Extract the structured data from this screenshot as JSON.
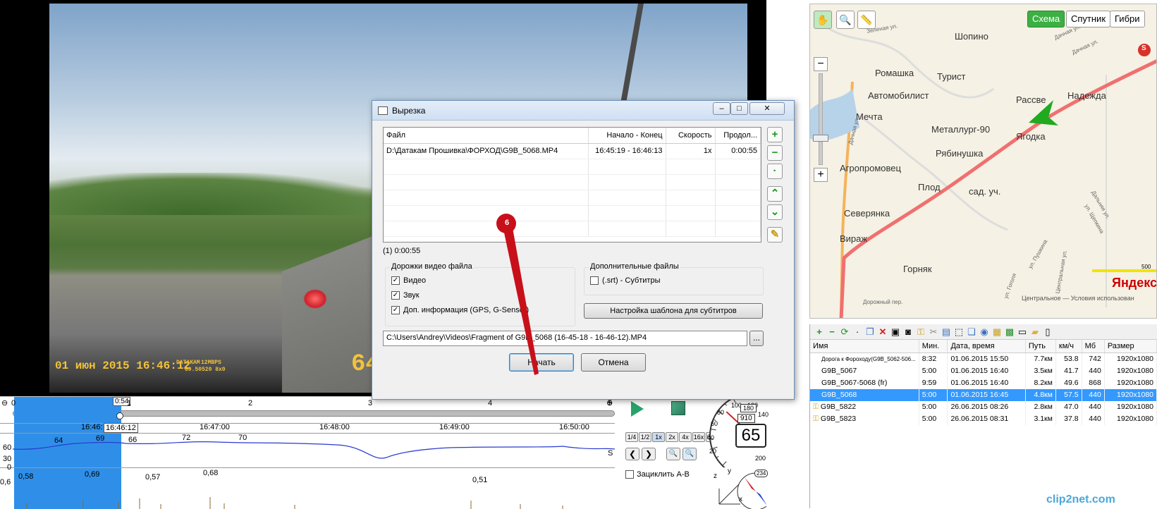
{
  "video": {
    "date_overlay": "01 июн 2015 16:46:12",
    "brand_overlay": "DATAKAM",
    "mbps_overlay": "12MBPS",
    "id_overlay": "G9.50520 8x0",
    "speed_overlay": "64"
  },
  "map": {
    "tools": {
      "hand": "hand-icon",
      "zoom": "zoom-box-icon",
      "ruler": "ruler-icon"
    },
    "buttons": {
      "scheme": "Схема",
      "satellite": "Спутник",
      "hybrid": "Гибри"
    },
    "zoom_minus": "−",
    "zoom_plus": "+",
    "towns": [
      "Шопино",
      "Ромашка",
      "Турист",
      "Автомобилист",
      "Рассве",
      "Надежда",
      "Мечта",
      "Металлург-90",
      "Ягодка",
      "Рябинушка",
      "Агропромовец",
      "Плод",
      "сад. уч.",
      "Северянка",
      "Вираж",
      "Горняк"
    ],
    "streets": [
      "Зеленая ул.",
      "Дачная ул.",
      "Дачная ул.",
      "Дачная ул.",
      "Дорожный пер.",
      "ул. Гоголя",
      "ул. Пушкина",
      "Центральная ул.",
      "Дальняя ул.",
      "ул. Щепкина"
    ],
    "marker_label": "S",
    "logo": "Яндекс",
    "scale": "500",
    "footer": "Центральное — Условия использован",
    "route_color": "#f07070",
    "button_active_color": "#3cb043"
  },
  "filepanel": {
    "toolbar_icons": [
      "plus-icon",
      "minus-icon",
      "refresh-icon",
      "dot-icon",
      "copy-icon",
      "delete-icon",
      "save-icon",
      "camera-icon",
      "key-icon",
      "scissors-icon",
      "add-icon",
      "crop-icon",
      "layers-icon",
      "globe-icon",
      "chart-icon",
      "picture-icon",
      "film-icon",
      "folder-icon",
      "doc-icon"
    ],
    "columns": [
      "Имя",
      "Мин.",
      "Дата, время",
      "Путь",
      "км/ч",
      "Мб",
      "Размер"
    ],
    "rows": [
      {
        "name": "Дорога к Фороходу(G9B_5062-506...",
        "min": "8:32",
        "date": "01.06.2015 15:50",
        "path": "7.7км",
        "speed": "53.8",
        "mb": "742",
        "size": "1920x1080",
        "selected": false,
        "key": false
      },
      {
        "name": "G9B_5067",
        "min": "5:00",
        "date": "01.06.2015 16:40",
        "path": "3.5км",
        "speed": "41.7",
        "mb": "440",
        "size": "1920x1080",
        "selected": false,
        "key": false
      },
      {
        "name": "G9B_5067-5068 (fr)",
        "min": "9:59",
        "date": "01.06.2015 16:40",
        "path": "8.2км",
        "speed": "49.6",
        "mb": "868",
        "size": "1920x1080",
        "selected": false,
        "key": false
      },
      {
        "name": "G9B_5068",
        "min": "5:00",
        "date": "01.06.2015 16:45",
        "path": "4.8км",
        "speed": "57.5",
        "mb": "440",
        "size": "1920x1080",
        "selected": true,
        "key": false
      },
      {
        "name": "G9B_5822",
        "min": "5:00",
        "date": "26.06.2015 08:26",
        "path": "2.8км",
        "speed": "47.0",
        "mb": "440",
        "size": "1920x1080",
        "selected": false,
        "key": true
      },
      {
        "name": "G9B_5823",
        "min": "5:00",
        "date": "26.06.2015 08:31",
        "path": "3.1км",
        "speed": "37.8",
        "mb": "440",
        "size": "1920x1080",
        "selected": false,
        "key": true
      }
    ],
    "watermark": "clip2net.com"
  },
  "timeline": {
    "minute_marks": [
      "1",
      "2",
      "3",
      "4",
      "5"
    ],
    "handle_label": "0:54",
    "zero": "0",
    "current_time": "16:46:12",
    "left_time": "16:46:",
    "times": [
      "16:47:00",
      "16:48:00",
      "16:49:00",
      "16:50:00"
    ],
    "speed_axis": [
      "60",
      "30",
      "0"
    ],
    "speed_labels": [
      "64",
      "69",
      "66",
      "72",
      "70"
    ],
    "speed_unit": "S",
    "g_axis": "0,6",
    "g_labels": [
      "0,58",
      "0,69",
      "0,57",
      "0,68",
      "0,51"
    ],
    "speed_buttons": [
      "1/4",
      "1/2",
      "1x",
      "2x",
      "4x",
      "16x",
      "64x"
    ],
    "loop_label": "Зациклить А-В",
    "speedometer": {
      "value": "65",
      "odometer": "910",
      "trip": "180",
      "ticks": [
        "20",
        "40",
        "60",
        "80",
        "100",
        "120",
        "140",
        "160",
        "180",
        "200"
      ],
      "speed_fraction": 0.325
    },
    "compass": {
      "heading": "234"
    },
    "axes": {
      "x": "x",
      "y": "y",
      "z": "z"
    }
  },
  "dialog": {
    "title": "Вырезка",
    "window_buttons": {
      "minimize": "–",
      "maximize": "□",
      "close": "✕"
    },
    "columns": [
      "Файл",
      "Начало - Конец",
      "Скорость",
      "Продол..."
    ],
    "rows": [
      {
        "file": "D:\\Датакам Прошивка\\ФОРХОД\\G9B_5068.MP4",
        "range": "16:45:19 - 16:46:13",
        "speed": "1x",
        "duration": "0:00:55"
      }
    ],
    "side_buttons": [
      "+",
      "−",
      "·",
      "⌃",
      "⌄",
      "✎"
    ],
    "summary": "(1) 0:00:55",
    "tracks_group": "Дорожки видео файла",
    "tracks": [
      {
        "label": "Видео",
        "checked": true
      },
      {
        "label": "Звук",
        "checked": true
      },
      {
        "label": "Доп. информация (GPS, G-Sensor)",
        "checked": true
      }
    ],
    "extra_group": "Дополнительные файлы",
    "extra": [
      {
        "label": "(.srt) - Субтитры",
        "checked": false
      }
    ],
    "subtitle_template_button": "Настройка шаблона для субтитров",
    "output_path": "C:\\Users\\Andrey\\Videos\\Fragment of G9B_5068 (16-45-18 - 16-46-12).MP4",
    "browse_button": "...",
    "start_button": "Начать",
    "cancel_button": "Отмена"
  },
  "annotation": {
    "number": "6"
  }
}
